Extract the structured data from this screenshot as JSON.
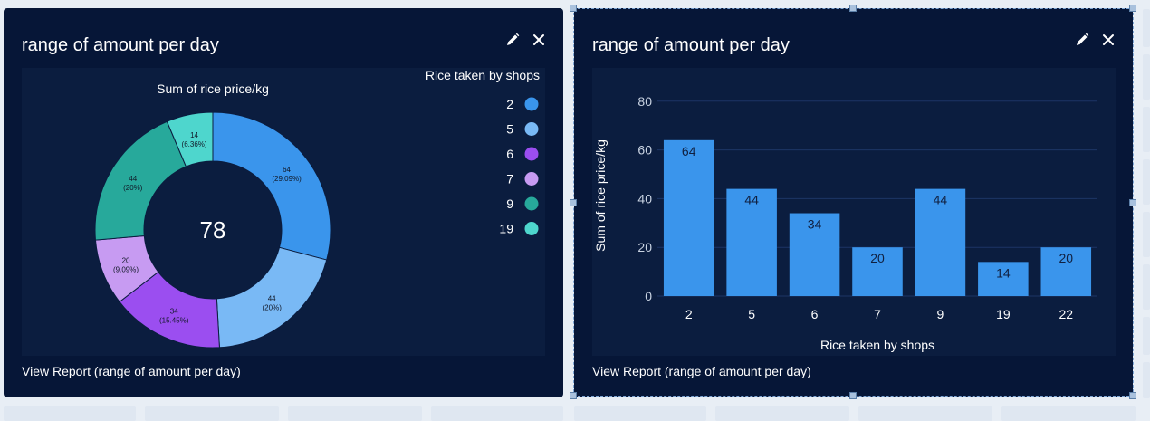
{
  "cards": [
    {
      "title": "range of amount per day",
      "footer": "View Report (range of amount per day)",
      "legend_title": "Rice taken by shops"
    },
    {
      "title": "range of amount per day",
      "footer": "View Report (range of amount per day)"
    }
  ],
  "chart_data": [
    {
      "type": "pie",
      "donut": true,
      "title": "Sum of rice price/kg",
      "center_label": "78",
      "legend_title": "Rice taken by shops",
      "legend_position": "top-right",
      "slices": [
        {
          "label": "2",
          "value": 64,
          "value_text": "64",
          "percent_text": "(29.09%)",
          "color": "#3a95ec"
        },
        {
          "label": "5",
          "value": 44,
          "value_text": "44",
          "percent_text": "(20%)",
          "color": "#79b9f5"
        },
        {
          "label": "6",
          "value": 34,
          "value_text": "34",
          "percent_text": "(15.45%)",
          "color": "#9b4ef0"
        },
        {
          "label": "7",
          "value": 20,
          "value_text": "20",
          "percent_text": "(9.09%)",
          "color": "#c79bf2"
        },
        {
          "label": "9",
          "value": 44,
          "value_text": "44",
          "percent_text": "(20%)",
          "color": "#27a99b"
        },
        {
          "label": "19",
          "value": 14,
          "value_text": "14",
          "percent_text": "(6.36%)",
          "color": "#4ed6cd"
        }
      ]
    },
    {
      "type": "bar",
      "title": "",
      "xlabel": "Rice taken by shops",
      "ylabel": "Sum of rice price/kg",
      "categories": [
        "2",
        "5",
        "6",
        "7",
        "9",
        "19",
        "22"
      ],
      "values": [
        64,
        44,
        34,
        20,
        44,
        14,
        20
      ],
      "ylim": [
        0,
        84
      ],
      "yticks": [
        0,
        20,
        40,
        60,
        80
      ],
      "grid": true,
      "bar_color": "#3a95ec"
    }
  ],
  "icons": {
    "edit": "pencil-icon",
    "close": "close-icon"
  }
}
